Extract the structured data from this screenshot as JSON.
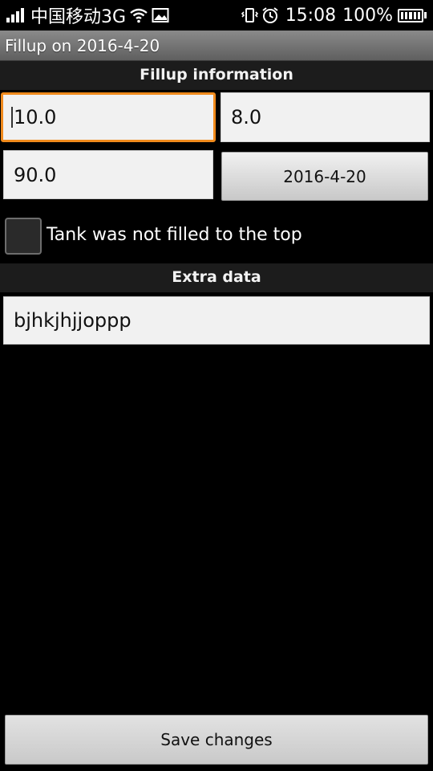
{
  "status_bar": {
    "carrier": "中国移动3G",
    "time": "15:08",
    "battery": "100%",
    "signal_icon": "signal-bars-icon",
    "wifi_icon": "wifi-icon",
    "image_icon": "image-notification-icon",
    "vibrate_icon": "vibrate-icon",
    "alarm_icon": "alarm-clock-icon",
    "battery_icon": "battery-full-icon",
    "battery_level": 1.0
  },
  "title_bar": {
    "title": "Fillup on 2016-4-20"
  },
  "fillup_section": {
    "header": "Fillup information",
    "field_1": {
      "value": "10.0"
    },
    "field_2": {
      "value": "8.0"
    },
    "field_3": {
      "value": "90.0"
    },
    "date_button": "2016-4-20",
    "checkbox": {
      "label": "Tank was not filled to the top",
      "checked": false
    }
  },
  "extra_section": {
    "header": "Extra data",
    "notes": {
      "value": "bjhkjhjjoppp"
    }
  },
  "actions": {
    "save_label": "Save changes"
  },
  "colors": {
    "focus_border": "#f08a1c",
    "background": "#000000",
    "field_background": "#f1f1f1"
  }
}
